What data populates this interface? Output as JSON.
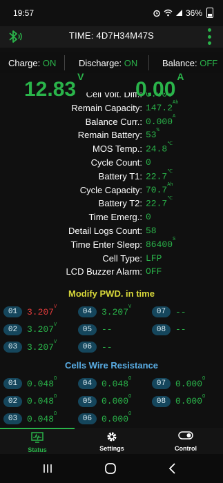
{
  "status_bar": {
    "time": "19:57",
    "battery_percent": "36%"
  },
  "app_bar": {
    "title": "TIME: 4D7H34M47S"
  },
  "toggles": {
    "charge_label": "Charge:",
    "charge_value": "ON",
    "discharge_label": "Discharge:",
    "discharge_value": "ON",
    "balance_label": "Balance:",
    "balance_value": "OFF"
  },
  "readings": {
    "voltage": "12.83",
    "voltage_unit": "V",
    "current": "0.00",
    "current_unit": "A"
  },
  "info_rows": [
    {
      "label": "Cell Volt. Diff.:",
      "value": "0.000",
      "unit": ""
    },
    {
      "label": "Remain Capacity:",
      "value": "147.2",
      "unit": "Ah"
    },
    {
      "label": "Balance Curr.:",
      "value": "0.000",
      "unit": "A"
    },
    {
      "label": "Remain Battery:",
      "value": "53",
      "unit": "%"
    },
    {
      "label": "MOS Temp.:",
      "value": "24.8",
      "unit": "℃"
    },
    {
      "label": "Cycle Count:",
      "value": "0",
      "unit": ""
    },
    {
      "label": "Battery T1:",
      "value": "22.7",
      "unit": "℃"
    },
    {
      "label": "Cycle Capacity:",
      "value": "70.7",
      "unit": "Ah"
    },
    {
      "label": "Battery T2:",
      "value": "22.7",
      "unit": "℃"
    },
    {
      "label": "Time Emerg.:",
      "value": "0",
      "unit": ""
    },
    {
      "label": "Detail Logs Count:",
      "value": "58",
      "unit": ""
    },
    {
      "label": "Time Enter Sleep:",
      "value": "86400",
      "unit": "S"
    },
    {
      "label": "Cell Type:",
      "value": "LFP",
      "unit": ""
    },
    {
      "label": "LCD Buzzer Alarm:",
      "value": "OFF",
      "unit": ""
    }
  ],
  "cells_section": {
    "title": "Modify PWD. in time",
    "cells": [
      {
        "num": "01",
        "value": "3.207",
        "unit": "V",
        "color": "red"
      },
      {
        "num": "04",
        "value": "3.207",
        "unit": "V",
        "color": "green"
      },
      {
        "num": "07",
        "value": "--",
        "unit": "",
        "color": "green"
      },
      {
        "num": "02",
        "value": "3.207",
        "unit": "V",
        "color": "green"
      },
      {
        "num": "05",
        "value": "--",
        "unit": "",
        "color": "green"
      },
      {
        "num": "08",
        "value": "--",
        "unit": "",
        "color": "green"
      },
      {
        "num": "03",
        "value": "3.207",
        "unit": "V",
        "color": "green"
      },
      {
        "num": "06",
        "value": "--",
        "unit": "",
        "color": "green"
      }
    ]
  },
  "resistance_section": {
    "title": "Cells Wire Resistance",
    "cells": [
      {
        "num": "01",
        "value": "0.048",
        "unit": "Ω"
      },
      {
        "num": "04",
        "value": "0.048",
        "unit": "Ω"
      },
      {
        "num": "07",
        "value": "0.000",
        "unit": "Ω"
      },
      {
        "num": "02",
        "value": "0.048",
        "unit": "Ω"
      },
      {
        "num": "05",
        "value": "0.000",
        "unit": "Ω"
      },
      {
        "num": "08",
        "value": "0.000",
        "unit": "Ω"
      },
      {
        "num": "03",
        "value": "0.048",
        "unit": "Ω"
      },
      {
        "num": "06",
        "value": "0.000",
        "unit": "Ω"
      }
    ]
  },
  "bottom_nav": [
    {
      "label": "Status",
      "icon": "monitor-icon",
      "active": true
    },
    {
      "label": "Settings",
      "icon": "gear-icon",
      "active": false
    },
    {
      "label": "Control",
      "icon": "toggle-icon",
      "active": false
    }
  ],
  "colors": {
    "accent": "#2ab44a",
    "alert": "#e23b3b",
    "section_title": "#d8d83a",
    "section_title_2": "#5aaee6"
  }
}
